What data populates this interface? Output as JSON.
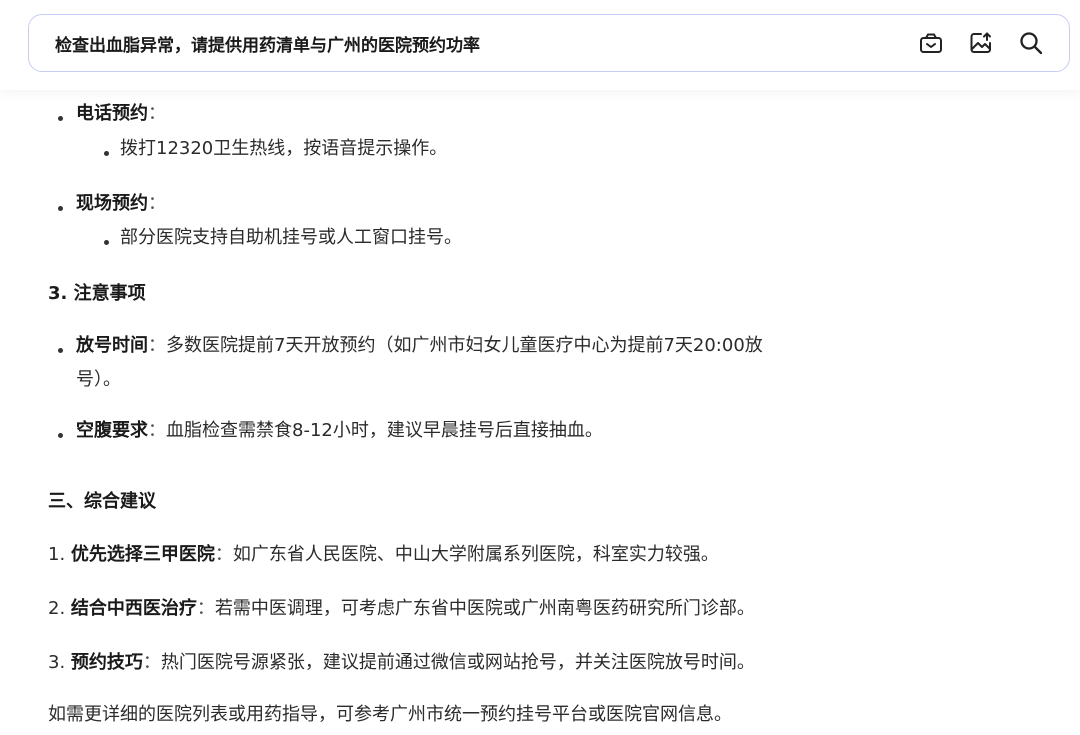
{
  "search": {
    "query": "检查出血脂异常，请提供用药清单与广州的医院预约功率",
    "icons": [
      "camera-icon",
      "image-upload-icon",
      "search-icon"
    ]
  },
  "content": {
    "phone": {
      "title": "电话预约",
      "sep": "：",
      "detail": "拨打12320卫生热线，按语音提示操作。"
    },
    "onsite": {
      "title": "现场预约",
      "sep": "：",
      "detail": "部分医院支持自助机挂号或人工窗口挂号。"
    },
    "notes_heading": "3. 注意事项",
    "release": {
      "title": "放号时间",
      "sep": "：",
      "detail_line1": "多数医院提前7天开放预约（如广州市妇女儿童医疗中心为提前7天20:00放",
      "detail_line2": "号）。"
    },
    "fasting": {
      "title": "空腹要求",
      "sep": "：",
      "detail": "血脂检查需禁食8-12小时，建议早晨挂号后直接抽血。"
    },
    "summary_heading": "三、综合建议",
    "advice": [
      {
        "num": "1.",
        "title": "优先选择三甲医院",
        "sep": "：",
        "detail": "如广东省人民医院、中山大学附属系列医院，科室实力较强。"
      },
      {
        "num": "2.",
        "title": "结合中西医治疗",
        "sep": "：",
        "detail": "若需中医调理，可考虑广东省中医院或广州南粤医药研究所门诊部。"
      },
      {
        "num": "3.",
        "title": "预约技巧",
        "sep": "：",
        "detail": "热门医院号源紧张，建议提前通过微信或网站抢号，并关注医院放号时间。"
      }
    ],
    "footer": "如需更详细的医院列表或用药指导，可参考广州市统一预约挂号平台或医院官网信息。"
  }
}
